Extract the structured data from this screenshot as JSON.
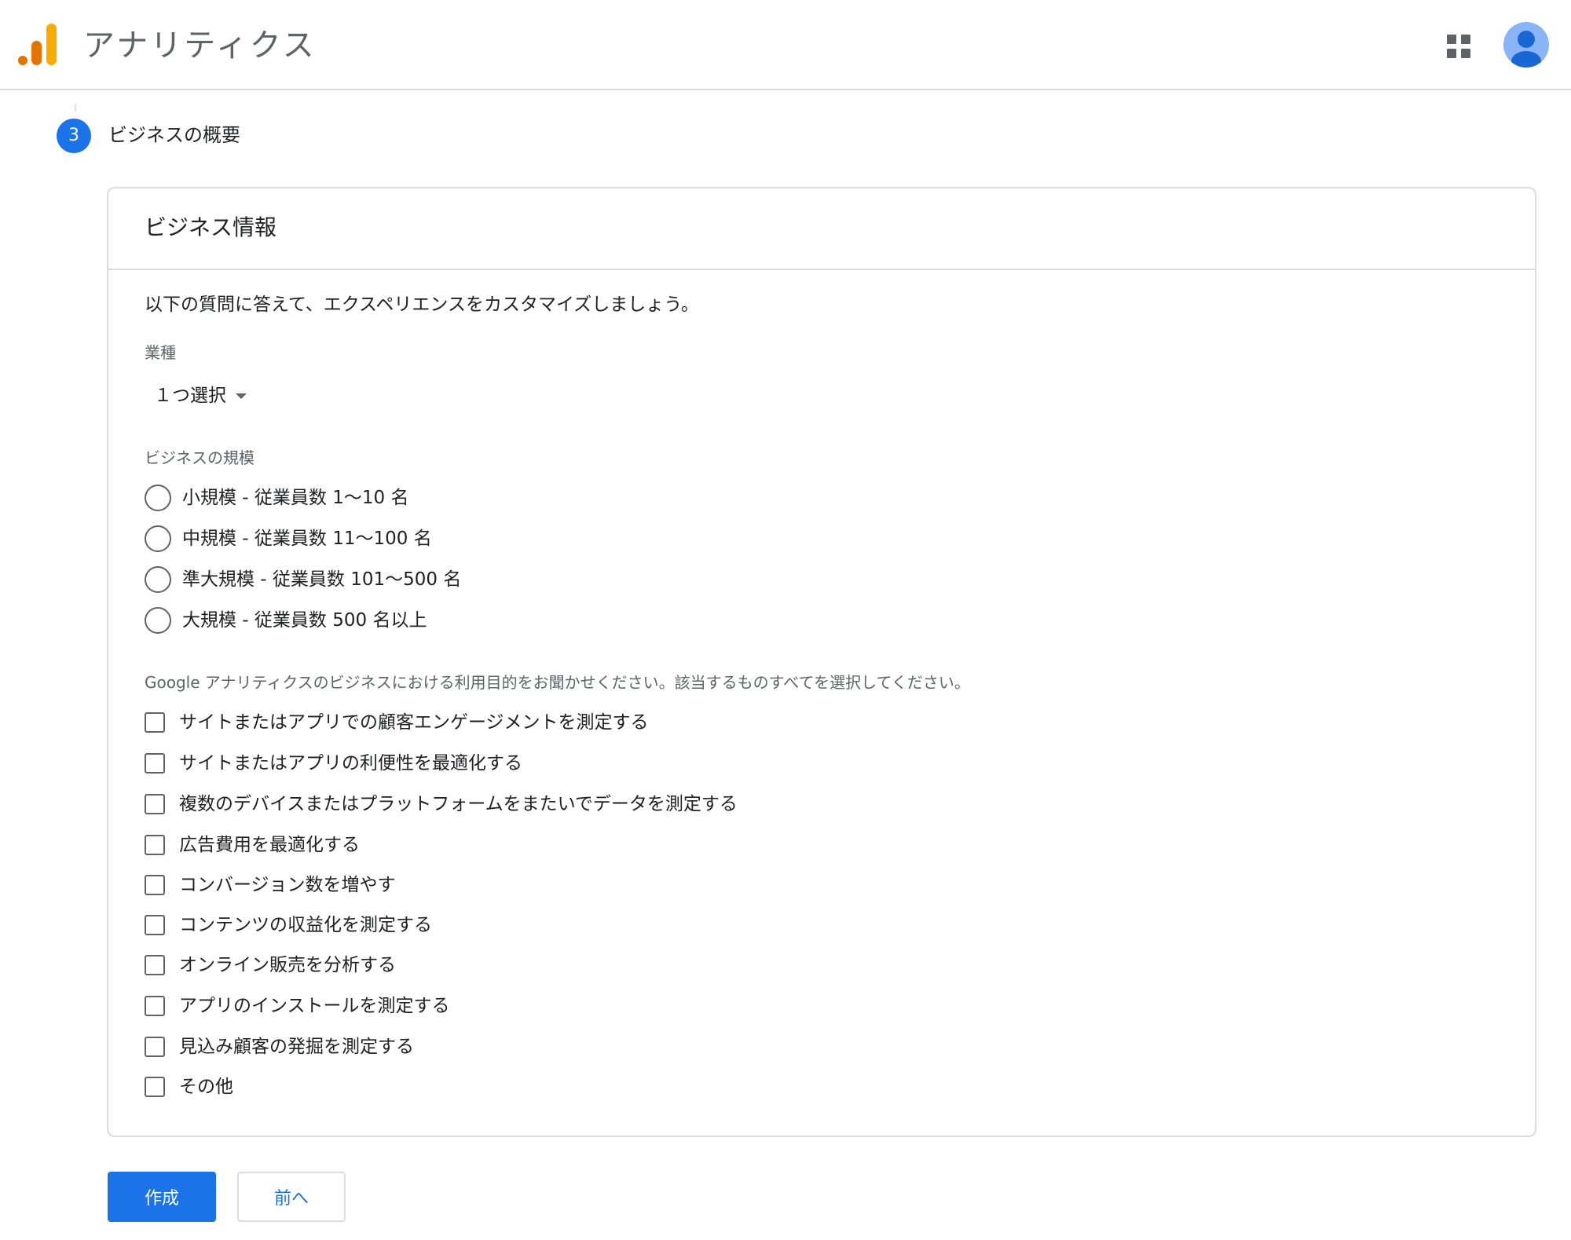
{
  "header": {
    "app_title": "アナリティクス",
    "logo_icon": "analytics-logo-icon",
    "apps_icon": "apps-grid-icon",
    "avatar_icon": "account-avatar-icon",
    "colors": {
      "logo_orange": "#f9ab00",
      "logo_dark_orange": "#e37400",
      "avatar_bg": "#8ab4f8",
      "avatar_fg": "#1967d2"
    }
  },
  "step": {
    "number": "3",
    "title": "ビジネスの概要"
  },
  "card": {
    "title": "ビジネス情報",
    "intro": "以下の質問に答えて、エクスペリエンスをカスタマイズしましょう。",
    "industry": {
      "label": "業種",
      "selected": "１つ選択"
    },
    "size": {
      "label": "ビジネスの規模",
      "options": [
        "小規模 - 従業員数 1～10 名",
        "中規模 - 従業員数 11～100 名",
        "準大規模 - 従業員数 101～500 名",
        "大規模 - 従業員数 500 名以上"
      ]
    },
    "purpose": {
      "label": "Google アナリティクスのビジネスにおける利用目的をお聞かせください。該当するものすべてを選択してください。",
      "options": [
        "サイトまたはアプリでの顧客エンゲージメントを測定する",
        "サイトまたはアプリの利便性を最適化する",
        "複数のデバイスまたはプラットフォームをまたいでデータを測定する",
        "広告費用を最適化する",
        "コンバージョン数を増やす",
        "コンテンツの収益化を測定する",
        "オンライン販売を分析する",
        "アプリのインストールを測定する",
        "見込み顧客の発掘を測定する",
        "その他"
      ]
    }
  },
  "buttons": {
    "create": "作成",
    "back": "前へ",
    "primary_color": "#1a73e8"
  }
}
